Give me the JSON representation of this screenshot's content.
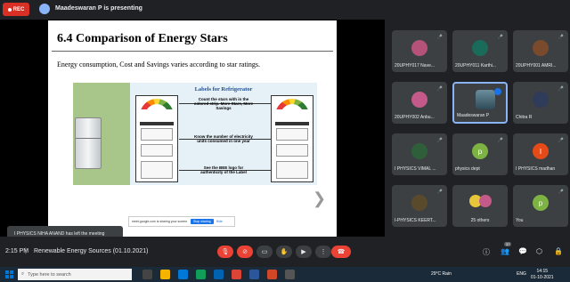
{
  "topbar": {
    "rec_label": "REC",
    "presenting_text": "Maadeswaran P is presenting"
  },
  "slide": {
    "title": "6.4 Comparison of Energy Stars",
    "subtitle": "Energy consumption, Cost and Savings varies according to star ratings.",
    "figure": {
      "heading": "Labels for Refrigerator",
      "callouts": [
        "Count the stars with in the colored strip. More Stars, More Savings",
        "Know the number of electricity units consumed in one year",
        "See the BEE logo for authenticity of the Label"
      ]
    },
    "next_arrow": "❯"
  },
  "share_bar": {
    "text": "meet.google.com is sharing your screen.",
    "stop_label": "Stop sharing",
    "hide_label": "Hide"
  },
  "toast": "I PHYSICS NIHA ANAND has left the meeting",
  "participants": [
    {
      "name": "20UPHY017 Nave...",
      "avatar_color": "#b5527a",
      "muted": true
    },
    {
      "name": "20UPHY011 Karthi...",
      "avatar_color": "#1a6b5a",
      "muted": true
    },
    {
      "name": "20UPHY001 AMRI...",
      "avatar_color": "#7a4a2c",
      "muted": true
    },
    {
      "name": "20UPHY002 Anbu...",
      "avatar_color": "#c45a8a",
      "muted": true
    },
    {
      "name": "Maadeswaran P",
      "avatar_color": "#5f7c8a",
      "muted": false
    },
    {
      "name": "Chitra R",
      "avatar_color": "#2e3c5a",
      "muted": true
    },
    {
      "name": "I PHYSICS VIMAL ...",
      "avatar_color": "#2f5f3a",
      "muted": true
    },
    {
      "name": "physics dept",
      "avatar_color": "#7cb342",
      "avatar_letter": "p",
      "muted": true
    },
    {
      "name": "I PHYSICS madhan",
      "avatar_color": "#e64a19",
      "avatar_letter": "I",
      "muted": true
    },
    {
      "name": "I-PHYSICS KEERT...",
      "avatar_color": "#5a4a2c",
      "muted": true
    },
    {
      "name": "25 others",
      "avatar_color": "#e8c63a",
      "muted": false
    },
    {
      "name": "You",
      "avatar_color": "#7cb342",
      "avatar_letter": "p",
      "muted": true
    }
  ],
  "meetbar": {
    "time": "2:15 PM",
    "separator": "|",
    "meeting_title": "Renewable Energy Sources (01.10.2021)",
    "participants_count": "37"
  },
  "taskbar": {
    "search_placeholder": "Type here to search",
    "weather": "29°C Rain",
    "language": "ENG",
    "time": "14:15",
    "date": "01-10-2021"
  },
  "colors": {
    "accent": "#8ab4f8",
    "danger": "#ea4335",
    "rec": "#d93025"
  }
}
